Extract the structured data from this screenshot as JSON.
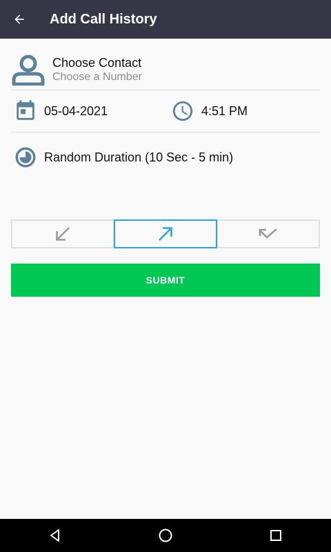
{
  "appbar": {
    "title": "Add Call History",
    "back_icon": "arrow-back-icon",
    "color": "#363646"
  },
  "contact": {
    "name_label": "Choose Contact",
    "number_placeholder": "Choose a Number",
    "icon": "person-icon"
  },
  "datetime": {
    "date": "05-04-2021",
    "time": "4:51 PM",
    "date_icon": "calendar-icon",
    "time_icon": "clock-icon"
  },
  "duration": {
    "label": "Random Duration (10 Sec - 5 min)",
    "icon": "duration-icon"
  },
  "call_types": {
    "items": [
      {
        "name": "incoming",
        "icon": "incoming-call-icon",
        "selected": false
      },
      {
        "name": "outgoing",
        "icon": "outgoing-call-icon",
        "selected": true
      },
      {
        "name": "missed",
        "icon": "missed-call-icon",
        "selected": false
      }
    ],
    "selected_color": "#2aa3e8"
  },
  "submit": {
    "label": "SUBMIT",
    "color": "#00c853"
  },
  "navbar": {
    "items": [
      "back-triangle-icon",
      "home-circle-icon",
      "recents-square-icon"
    ]
  }
}
